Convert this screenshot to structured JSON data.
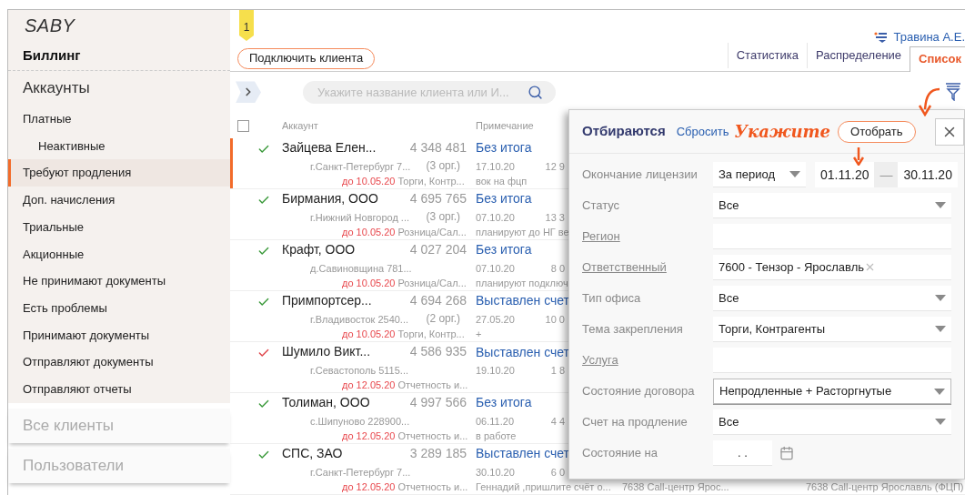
{
  "sidebar": {
    "logo": "SABY",
    "title": "Биллинг",
    "sections": [
      {
        "label": "Аккаунты",
        "expanded": true,
        "items": [
          {
            "label": "Платные",
            "selected": false,
            "children": [
              {
                "label": "Неактивные",
                "selected": false
              }
            ]
          },
          {
            "label": "Требуют продления",
            "selected": true
          },
          {
            "label": "Доп. начисления",
            "selected": false
          },
          {
            "label": "Триальные",
            "selected": false
          },
          {
            "label": "Акционные",
            "selected": false
          },
          {
            "label": "Не принимают документы",
            "selected": false
          },
          {
            "label": "Есть проблемы",
            "selected": false
          },
          {
            "label": "Принимают документы",
            "selected": false
          },
          {
            "label": "Отправляют документы",
            "selected": false
          },
          {
            "label": "Отправляют отчеты",
            "selected": false
          }
        ]
      },
      {
        "label": "Все клиенты",
        "expanded": false
      },
      {
        "label": "Пользователи",
        "expanded": false
      }
    ]
  },
  "header": {
    "badge": "1",
    "user": "Травина А.Е."
  },
  "connect_button": "Подключить клиента",
  "tabs": [
    {
      "label": "Статистика",
      "selected": false
    },
    {
      "label": "Распределение",
      "selected": false
    },
    {
      "label": "Список",
      "selected": true
    }
  ],
  "search": {
    "placeholder": "Укажите название клиента или И..."
  },
  "table": {
    "select_all": {
      "checked": false
    },
    "columns": [
      "Аккаунт",
      "Примечание"
    ],
    "rows": [
      {
        "selected": true,
        "color": "#3c9a3c",
        "name": "Зайцева Елен...",
        "account": "4 348 481",
        "address": "г.Санкт-Петербург 7...",
        "orgs": "(3 орг.)",
        "due": "до 10.05.20",
        "tags": "Торги, Контр...",
        "status": "Без итога",
        "date": "17.10.20",
        "column_3": "12 9",
        "note": "вок на фцп"
      },
      {
        "selected": false,
        "color": "#3c9a3c",
        "name": "Бирмания, ООО",
        "account": "4 695 765",
        "address": "г.Нижний Новгород ...",
        "orgs": "(3 орг.)",
        "due": "до 10.05.20",
        "tags": "Розница/Сал...",
        "status": "Без итога",
        "date": "07.10.20",
        "column_3": "13 3",
        "note": "планируют до НГ ве"
      },
      {
        "selected": false,
        "color": "#3c9a3c",
        "name": "Крафт, ООО",
        "account": "4 027 204",
        "address": "д.Савиновщина 781...",
        "due": "до 10.05.20",
        "tags": "Розница/Сал...",
        "status": "Без итога",
        "date": "07.10.20",
        "column_3": "8 0",
        "note": "планируют подключ"
      },
      {
        "selected": false,
        "color": "#3c9a3c",
        "name": "Примпортсер...",
        "account": "4 694 268",
        "address": "г.Владивосток 2540...",
        "orgs": "(2 орг.)",
        "due": "до 10.05.20",
        "tags": "Торги, Контр...",
        "status": "Выставлен счет",
        "date": "27.05.20",
        "column_3": "10 0",
        "note": "+"
      },
      {
        "selected": false,
        "color": "#e0474c",
        "name": "Шумило Викт...",
        "account": "4 586 935",
        "address": "г.Севастополь 5115...",
        "due": "до 12.05.20",
        "tags": "Отчетность и...",
        "status": "Выставлен счет",
        "date": "19.10.20",
        "column_3": "1 8"
      },
      {
        "selected": false,
        "color": "#3c9a3c",
        "name": "Толиман, ООО",
        "account": "4 997 566",
        "address": "с.Шипуново 228900...",
        "due": "до 12.05.20",
        "tags": "Отчетность и...",
        "status": "Без итога",
        "date": "06.11.20",
        "column_3": "4 4",
        "note": "в работе"
      },
      {
        "selected": false,
        "color": "#3c9a3c",
        "name": "СПС, ЗАО",
        "account": "3 289 185",
        "address": "г.Санкт-Петербург 7...",
        "due": "до 12.05.20",
        "tags": "Отчетность и...",
        "status": "Выставлен счет",
        "date": "30.10.20",
        "column_3": "6 0",
        "note": "Геннадий ,пришлите счёт о...",
        "column_4": "7638 Call-центр Ярос...",
        "column_5": "7638 Call-центр Ярославль (ФЦП)"
      }
    ]
  },
  "filter_panel": {
    "title": "Отбираются",
    "reset": "Сбросить",
    "hint": "Укажите",
    "apply": "Отобрать",
    "fields": [
      {
        "kind": "range",
        "label": "Окончание лицензии",
        "link": false,
        "focused": false,
        "value": "За период",
        "from": "01.11.20",
        "separator": "—",
        "to": "30.11.20"
      },
      {
        "kind": "select",
        "label": "Статус",
        "link": false,
        "focused": false,
        "value": "Все"
      },
      {
        "kind": "text",
        "label": "Регион",
        "link": true,
        "focused": false
      },
      {
        "kind": "tag",
        "label": "Ответственный",
        "link": true,
        "focused": false,
        "value": "7600 - Тензор - Ярославль"
      },
      {
        "kind": "select",
        "label": "Тип офиса",
        "link": false,
        "focused": false,
        "value": "Все"
      },
      {
        "kind": "select",
        "label": "Тема закрепления",
        "link": false,
        "focused": false,
        "value": "Торги, Контрагенты"
      },
      {
        "kind": "text",
        "label": "Услуга",
        "link": true,
        "focused": false
      },
      {
        "kind": "select",
        "label": "Состояние договора",
        "link": false,
        "focused": true,
        "value": "Непродленные + Расторгнутые"
      },
      {
        "kind": "select",
        "label": "Счет на продление",
        "link": false,
        "focused": false,
        "value": "Все"
      },
      {
        "kind": "date",
        "label": "Состояние на",
        "link": false,
        "focused": false,
        "placeholder": ". ."
      }
    ]
  }
}
